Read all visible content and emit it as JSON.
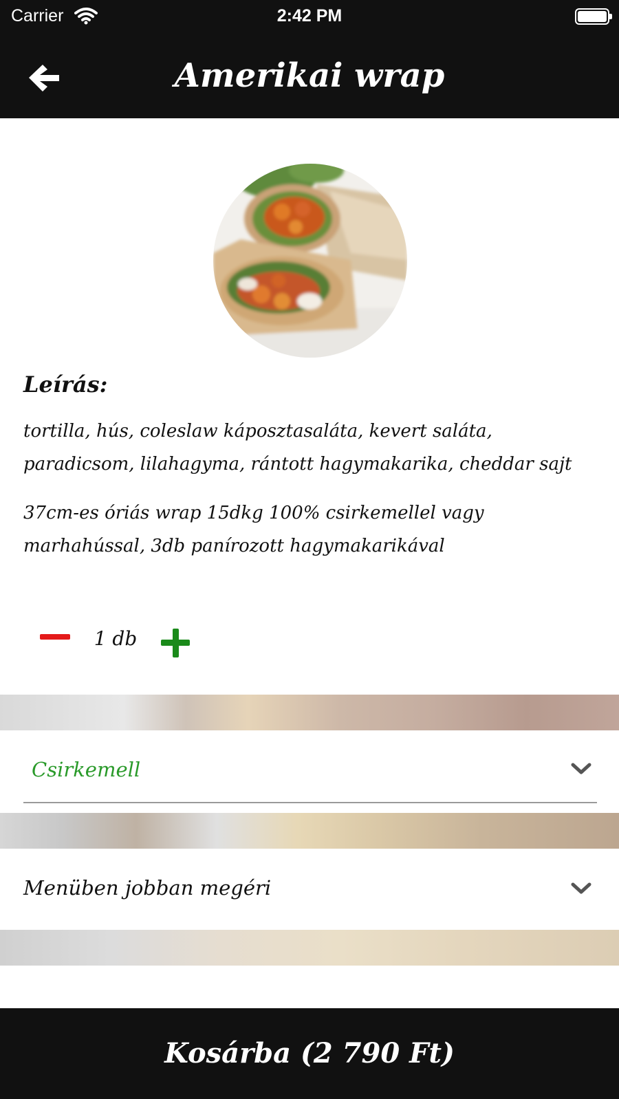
{
  "status_bar": {
    "carrier": "Carrier",
    "time": "2:42 PM",
    "icons": [
      "wifi-icon",
      "battery-icon"
    ]
  },
  "nav": {
    "title": "Amerikai wrap",
    "back_icon": "arrow-left-icon"
  },
  "product": {
    "image": "wrap-photo",
    "description_heading": "Leírás:",
    "ingredients": "tortilla, hús, coleslaw káposztasaláta, kevert saláta, paradicsom, lilahagyma, rántott hagymakarika, cheddar sajt",
    "details": "37cm-es óriás wrap 15dkg 100% csirkemellel vagy marhahússal, 3db panírozott hagymakarikával"
  },
  "quantity": {
    "value": "1 db",
    "minus_color": "#e41a1a",
    "plus_color": "#1a8a1a"
  },
  "options": {
    "meat": {
      "selected": "Csirkemell",
      "color": "#2a9a2a"
    },
    "menu": {
      "selected": "Menüben jobban megéri"
    }
  },
  "cart": {
    "label": "Kosárba (2 790 Ft)"
  },
  "colors": {
    "header_bg": "#111111",
    "accent_green": "#2a9a2a"
  }
}
